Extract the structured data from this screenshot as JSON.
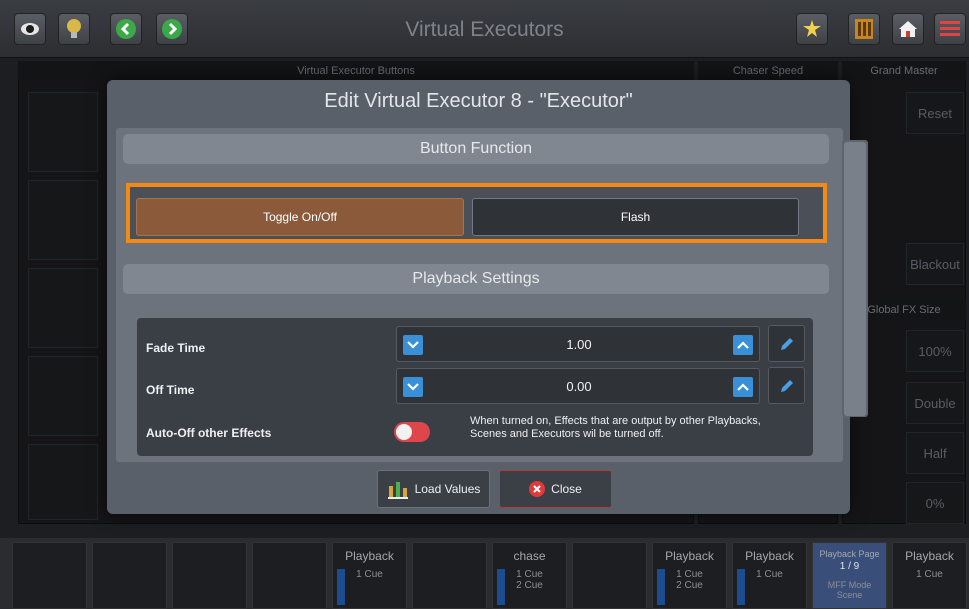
{
  "topbar": {
    "title": "Virtual Executors",
    "left_icons": [
      "eye-icon",
      "lightbulb-icon",
      "chevron-left-icon",
      "chevron-right-icon"
    ],
    "right_icons": [
      "magic-icon",
      "columns-icon",
      "home-icon",
      "menu-icon"
    ]
  },
  "background": {
    "headers": {
      "buttons": "Virtual Executor Buttons",
      "chaser_speed": "Chaser Speed",
      "grand_master": "Grand Master",
      "global_fx_size": "Global FX Size"
    },
    "grand_master_buttons": [
      "Reset",
      "Blackout"
    ],
    "fx_size_buttons": [
      "100%",
      "Double",
      "Half",
      "0%"
    ],
    "playbacks": [
      {
        "name": "Playback",
        "cue": "1 Cue",
        "sub": "-",
        "pct": "100%"
      },
      {
        "name": "chase",
        "cue": "1 Cue",
        "sub": "2 Cue",
        "pct": "100%"
      },
      {
        "name": "Playback",
        "cue": "1 Cue",
        "sub": "2 Cue",
        "pct": "100%"
      },
      {
        "name": "Playback",
        "cue": "1 Cue",
        "sub": "-",
        "pct": "100%"
      },
      {
        "name": "Playback",
        "cue": "1 Cue",
        "sub": "-",
        "pct": "0%"
      }
    ],
    "playback_page": {
      "label": "Playback Page",
      "value": "1 / 9",
      "mode": "MFF Mode",
      "mode_value": "Scene"
    }
  },
  "dialog": {
    "title": "Edit Virtual Executor 8 - \"Executor\"",
    "button_function_header": "Button Function",
    "options": [
      {
        "label": "Toggle On/Off",
        "selected": true
      },
      {
        "label": "Flash",
        "selected": false
      }
    ],
    "playback_settings_header": "Playback Settings",
    "fade_time": {
      "label": "Fade Time",
      "value": "1.00"
    },
    "off_time": {
      "label": "Off Time",
      "value": "0.00"
    },
    "auto_off": {
      "label": "Auto-Off other Effects",
      "enabled": false,
      "description": "When turned on, Effects that are output by other Playbacks, Scenes and Executors wil be turned off."
    },
    "load_values_label": "Load Values",
    "close_label": "Close"
  },
  "colors": {
    "highlight": "#f28a14",
    "selected": "#8a5a3a",
    "accent": "#3a8fd9",
    "toggle_off": "#e0454a"
  }
}
